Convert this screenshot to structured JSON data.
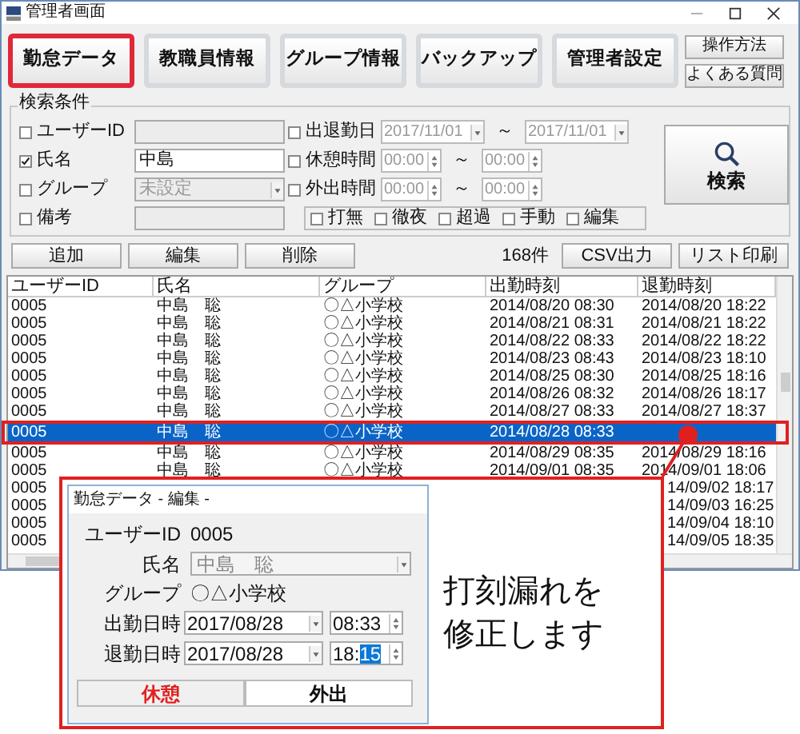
{
  "window": {
    "title": "管理者画面"
  },
  "nav": [
    {
      "label": "勤怠データ",
      "selected": true
    },
    {
      "label": "教職員情報",
      "selected": false
    },
    {
      "label": "グループ情報",
      "selected": false
    },
    {
      "label": "バックアップ",
      "selected": false
    },
    {
      "label": "管理者設定",
      "selected": false
    }
  ],
  "help_buttons": [
    "操作方法",
    "よくある質問"
  ],
  "search": {
    "legend": "検索条件",
    "left_fields": [
      {
        "kind": "text",
        "label": "ユーザーID",
        "checked": false
      },
      {
        "kind": "text",
        "label": "氏名",
        "checked": true,
        "value": "中島"
      },
      {
        "kind": "select",
        "label": "グループ",
        "checked": false,
        "value": "未設定"
      },
      {
        "kind": "text",
        "label": "備考",
        "checked": false
      }
    ],
    "right_fields": [
      {
        "kind": "date",
        "label": "出退勤日",
        "checked": false,
        "from": "2017/11/01",
        "separator": "～",
        "to": "2017/11/01"
      },
      {
        "kind": "time",
        "label": "休憩時間",
        "checked": false,
        "from": "00:00",
        "separator": "～",
        "to": "00:00"
      },
      {
        "kind": "time",
        "label": "外出時間",
        "checked": false,
        "from": "00:00",
        "separator": "～",
        "to": "00:00"
      }
    ],
    "flags": [
      {
        "label": "打無",
        "checked": false
      },
      {
        "label": "徹夜",
        "checked": false
      },
      {
        "label": "超過",
        "checked": false
      },
      {
        "label": "手動",
        "checked": false
      },
      {
        "label": "編集",
        "checked": false
      }
    ],
    "button": "検索"
  },
  "actions": [
    "追加",
    "編集",
    "削除"
  ],
  "count": "168件",
  "exports": [
    "CSV出力",
    "リスト印刷"
  ],
  "table": {
    "columns": [
      "ユーザーID",
      "氏名",
      "グループ",
      "出勤時刻",
      "退勤時刻"
    ],
    "rows": [
      {
        "selected": false,
        "cells": [
          "0005",
          "中島　聡",
          "〇△小学校",
          "2014/08/20 08:30",
          "2014/08/20 18:22"
        ]
      },
      {
        "selected": false,
        "cells": [
          "0005",
          "中島　聡",
          "〇△小学校",
          "2014/08/21 08:31",
          "2014/08/21 18:22"
        ]
      },
      {
        "selected": false,
        "cells": [
          "0005",
          "中島　聡",
          "〇△小学校",
          "2014/08/22 08:33",
          "2014/08/22 18:22"
        ]
      },
      {
        "selected": false,
        "cells": [
          "0005",
          "中島　聡",
          "〇△小学校",
          "2014/08/23 08:43",
          "2014/08/23 18:10"
        ]
      },
      {
        "selected": false,
        "cells": [
          "0005",
          "中島　聡",
          "〇△小学校",
          "2014/08/25 08:30",
          "2014/08/25 18:16"
        ]
      },
      {
        "selected": false,
        "cells": [
          "0005",
          "中島　聡",
          "〇△小学校",
          "2014/08/26 08:32",
          "2014/08/26 18:17"
        ]
      },
      {
        "selected": false,
        "cells": [
          "0005",
          "中島　聡",
          "〇△小学校",
          "2014/08/27 08:33",
          "2014/08/27 18:37"
        ]
      },
      {
        "selected": true,
        "cells": [
          "0005",
          "中島　聡",
          "〇△小学校",
          "2014/08/28 08:33"
        ]
      },
      {
        "selected": false,
        "cells": [
          "0005",
          "中島　聡",
          "〇△小学校",
          "2014/08/29 08:35",
          "2014/08/29 18:16"
        ]
      },
      {
        "selected": false,
        "cells": [
          "0005",
          "中島　聡",
          "〇△小学校",
          "2014/09/01 08:35",
          "2014/09/01 18:06"
        ]
      },
      {
        "selected": false,
        "cells": [
          "0005",
          null,
          null,
          null,
          "14/09/02 18:17"
        ]
      },
      {
        "selected": false,
        "cells": [
          "0005",
          null,
          null,
          null,
          "14/09/03 16:25"
        ]
      },
      {
        "selected": false,
        "cells": [
          "0005",
          null,
          null,
          null,
          "14/09/04 18:10"
        ]
      },
      {
        "selected": false,
        "cells": [
          "0005",
          null,
          null,
          null,
          "14/09/05 18:35"
        ]
      }
    ]
  },
  "callout": {
    "dialog": {
      "title": "勤怠データ - 編集 -",
      "user_id_label": "ユーザーID",
      "user_id": "0005",
      "name_label": "氏名",
      "name": "中島　聡",
      "group_label": "グループ",
      "group": "〇△小学校",
      "clock_in_label": "出勤日時",
      "clock_in_date": "2017/08/28",
      "clock_in_hour": "08:",
      "clock_in_minute": "33",
      "clock_out_label": "退勤日時",
      "clock_out_date": "2017/08/28",
      "clock_out_hour": "18:",
      "clock_out_minute": "15",
      "tabs": [
        {
          "label": "休憩",
          "selected": true
        },
        {
          "label": "外出",
          "selected": false
        }
      ]
    },
    "message": "打刻漏れを修正します"
  }
}
